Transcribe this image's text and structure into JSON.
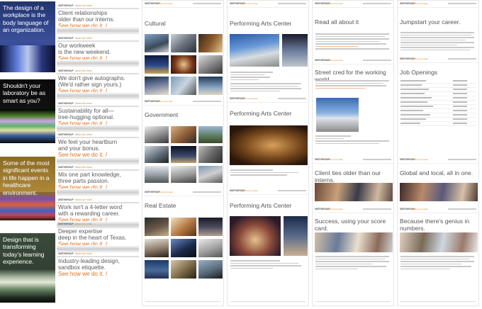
{
  "banners": [
    {
      "text": "The design of a workplace is the body language of an organization."
    },
    {
      "text": "Shouldn't your laboratory be as smart as you?"
    },
    {
      "text": "Some of the most significant events in life happen in a healthcare environment."
    },
    {
      "text": "Design that is transforming today's learning experience."
    }
  ],
  "brand": {
    "logo": "SMITHGROUP",
    "tagline": "Attract and retain"
  },
  "slices": [
    {
      "line1": "Client relationships",
      "line2": "older than our interns.",
      "link": "See how we do it. /"
    },
    {
      "line1": "Our workweek",
      "line2": "is the new weekend.",
      "link": "See how we do it. /"
    },
    {
      "line1": "We don't give autographs.",
      "line2": "(We'd rather sign yours.)",
      "link": "See how we do it. /"
    },
    {
      "line1": "Sustainability for all—",
      "line2": "tree-hugging optional.",
      "link": "See how we do it. /"
    },
    {
      "line1": "We feel your heartburn",
      "line2": "and your bonus.",
      "link": "See how we do it. /"
    },
    {
      "line1": "Mix one part knowledge,",
      "line2": "three parts passion.",
      "link": "See how we do it. /"
    },
    {
      "line1": "Work isn't a 4-letter word",
      "line2": "with a rewarding career.",
      "link": "See how we do it. /"
    },
    {
      "line1": "Deeper expertise",
      "line2": "deep in the heart of Texas.",
      "link": "See how we do it. /"
    },
    {
      "line1": "Industry-leading design,",
      "line2": "sandbox etiquette.",
      "link": "See how we do it. /"
    }
  ],
  "col3": {
    "cultural": "Cultural",
    "government": "Government",
    "realestate": "Real Estate"
  },
  "col4": {
    "pac1": "Performing Arts Center",
    "pac2": "Performing Arts Center",
    "pac3": "Performing Arts Center"
  },
  "col5": {
    "read": "Read all about it",
    "street": "Street cred for the working world.",
    "client": "Client ties older than our interns.",
    "success": "Success, using your score card."
  },
  "col6": {
    "jump": "Jumpstart your career.",
    "jobs": "Job Openings",
    "global": "Global and local, all in one.",
    "genius": "Because there's genius in numbers."
  },
  "colors": {
    "accent": "#e0701f",
    "text": "#5a5a5a"
  }
}
